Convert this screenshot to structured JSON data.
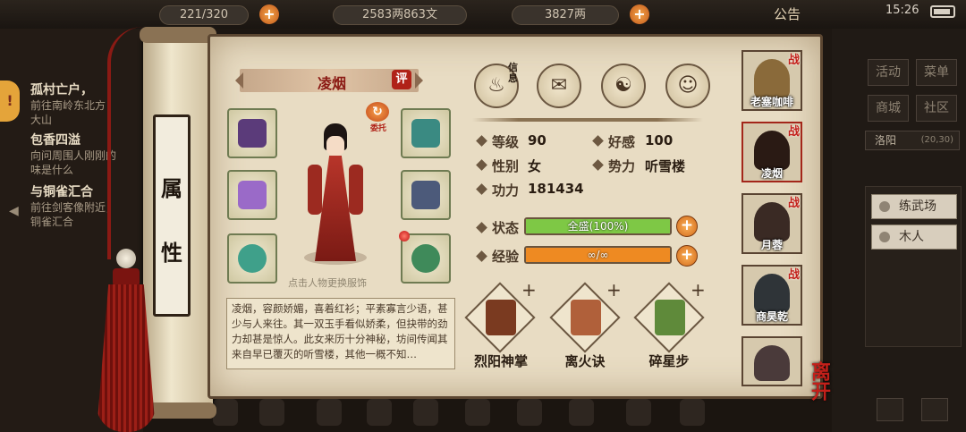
{
  "hud": {
    "energy": "221/320",
    "money": "2583两863文",
    "gold": "3827两",
    "notice": "公告",
    "time": "15:26"
  },
  "quests": [
    {
      "title": "孤村亡户，",
      "desc": "前往南岭东北方\n大山"
    },
    {
      "title": "包香四溢",
      "desc": "向问周围人刚刚的\n味是什么"
    },
    {
      "title": "与铜雀汇合",
      "desc": "前往剑客像附近，\n铜雀汇合"
    }
  ],
  "right_menu": {
    "buttons": [
      "活动",
      "菜单",
      "商城",
      "社区"
    ],
    "location": "洛阳",
    "location_coord": "(20,30)",
    "list": [
      "练武场",
      "木人"
    ]
  },
  "scroll": {
    "label_1": "属",
    "label_2": "性"
  },
  "character": {
    "name": "凌烟",
    "eval": "评",
    "entrust": "委托",
    "change_hint": "点击人物更换服饰",
    "description": "凌烟，容颜娇媚，喜着红衫；平素寡言少语，甚少与人来往。其一双玉手看似娇柔，但抉带的劲力却甚是惊人。此女来历十分神秘，坊间传闻其来自早已覆灭的听雪楼，其他一概不知…"
  },
  "tabs": [
    {
      "name": "info-tab",
      "label": "信息",
      "icon": "pot-icon"
    },
    {
      "name": "scroll-tab",
      "icon": "map-scroll-icon"
    },
    {
      "name": "bagua-tab",
      "icon": "bagua-icon"
    },
    {
      "name": "meridian-tab",
      "icon": "body-meridian-icon"
    }
  ],
  "stats": {
    "level_label": "等级",
    "level": "90",
    "favor_label": "好感",
    "favor": "100",
    "gender_label": "性别",
    "gender": "女",
    "faction_label": "势力",
    "faction": "听雪楼",
    "power_label": "功力",
    "power": "181434",
    "status_label": "状态",
    "status_text": "全盛(100%)",
    "status_fill": 1.0,
    "exp_label": "经验",
    "exp_text": "∞/∞",
    "exp_fill": 1.0
  },
  "skills": [
    {
      "name": "烈阳神掌",
      "icon": "book-icon",
      "plus": "+"
    },
    {
      "name": "离火诀",
      "icon": "scroll-icon",
      "plus": "+"
    },
    {
      "name": "碎星步",
      "icon": "jade-scroll-icon",
      "plus": "+"
    }
  ],
  "companions": [
    {
      "name": "老塞咖啡",
      "tag": "战"
    },
    {
      "name": "凌烟",
      "tag": "战"
    },
    {
      "name": "月蓉",
      "tag": "战"
    },
    {
      "name": "商昊乾",
      "tag": "战"
    },
    {
      "name": "",
      "tag": ""
    }
  ],
  "leave_label": "离开",
  "colors": {
    "status_bar": "#7ec845",
    "exp_bar": "#ee8a22",
    "accent_red": "#b02218",
    "parchment": "#e8dcc3"
  }
}
